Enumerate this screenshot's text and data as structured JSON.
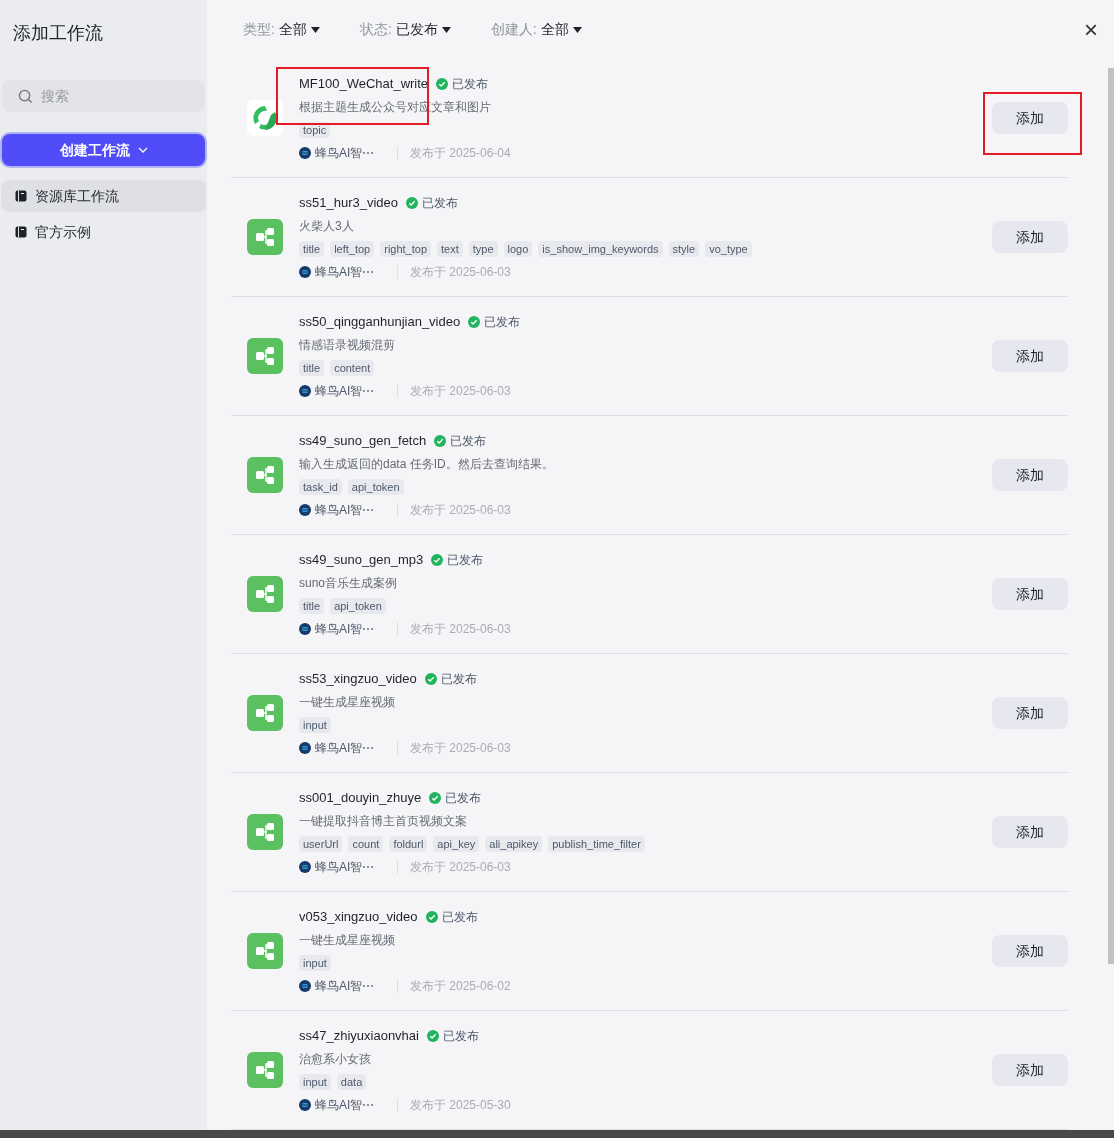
{
  "sidebar": {
    "title": "添加工作流",
    "search": {
      "placeholder": "搜索"
    },
    "create_button": "创建工作流",
    "items": [
      {
        "label": "资源库工作流",
        "selected": true
      },
      {
        "label": "官方示例",
        "selected": false
      }
    ]
  },
  "filters": [
    {
      "label": "类型:",
      "value": "全部"
    },
    {
      "label": "状态:",
      "value": "已发布"
    },
    {
      "label": "创建人:",
      "value": "全部"
    }
  ],
  "close": "×",
  "workflows": [
    {
      "kind": "wechat",
      "name": "MF100_WeChat_write",
      "status": "已发布",
      "description": "根据主题生成公众号对应文章和图片",
      "tags": [
        "topic"
      ],
      "author": "蜂鸟AI智⋯",
      "published": "发布于 2025-06-04",
      "button": "添加",
      "annotated": true
    },
    {
      "kind": "flow",
      "name": "ss51_hur3_video",
      "status": "已发布",
      "description": "火柴人3人",
      "tags": [
        "title",
        "left_top",
        "right_top",
        "text",
        "type",
        "logo",
        "is_show_img_keywords",
        "style",
        "vo_type"
      ],
      "author": "蜂鸟AI智⋯",
      "published": "发布于 2025-06-03",
      "button": "添加",
      "annotated": false
    },
    {
      "kind": "flow",
      "name": "ss50_qingganhunjian_video",
      "status": "已发布",
      "description": "情感语录视频混剪",
      "tags": [
        "title",
        "content"
      ],
      "author": "蜂鸟AI智⋯",
      "published": "发布于 2025-06-03",
      "button": "添加",
      "annotated": false
    },
    {
      "kind": "flow",
      "name": "ss49_suno_gen_fetch",
      "status": "已发布",
      "description": "输入生成返回的data 任务ID。然后去查询结果。",
      "tags": [
        "task_id",
        "api_token"
      ],
      "author": "蜂鸟AI智⋯",
      "published": "发布于 2025-06-03",
      "button": "添加",
      "annotated": false
    },
    {
      "kind": "flow",
      "name": "ss49_suno_gen_mp3",
      "status": "已发布",
      "description": "suno音乐生成案例",
      "tags": [
        "title",
        "api_token"
      ],
      "author": "蜂鸟AI智⋯",
      "published": "发布于 2025-06-03",
      "button": "添加",
      "annotated": false
    },
    {
      "kind": "flow",
      "name": "ss53_xingzuo_video",
      "status": "已发布",
      "description": "一键生成星座视频",
      "tags": [
        "input"
      ],
      "author": "蜂鸟AI智⋯",
      "published": "发布于 2025-06-03",
      "button": "添加",
      "annotated": false
    },
    {
      "kind": "flow",
      "name": "ss001_douyin_zhuye",
      "status": "已发布",
      "description": "一键提取抖音博主首页视频文案",
      "tags": [
        "userUrl",
        "count",
        "foldurl",
        "api_key",
        "ali_apikey",
        "publish_time_filter"
      ],
      "author": "蜂鸟AI智⋯",
      "published": "发布于 2025-06-03",
      "button": "添加",
      "annotated": false
    },
    {
      "kind": "flow",
      "name": "v053_xingzuo_video",
      "status": "已发布",
      "description": "一键生成星座视频",
      "tags": [
        "input"
      ],
      "author": "蜂鸟AI智⋯",
      "published": "发布于 2025-06-02",
      "button": "添加",
      "annotated": false
    },
    {
      "kind": "flow",
      "name": "ss47_zhiyuxiaonvhai",
      "status": "已发布",
      "description": "治愈系小女孩",
      "tags": [
        "input",
        "data"
      ],
      "author": "蜂鸟AI智⋯",
      "published": "发布于 2025-05-30",
      "button": "添加",
      "annotated": false
    }
  ]
}
